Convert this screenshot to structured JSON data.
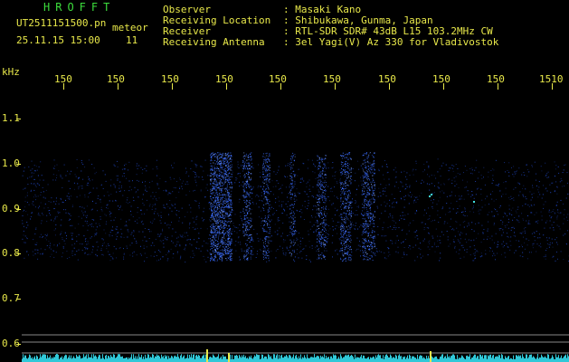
{
  "header": {
    "title": "HROFFT",
    "filename": "UT2511151500.pn",
    "mode": "meteor",
    "datetime": "25.11.15 15:00",
    "count": "11",
    "observer_label": "Observer",
    "observer_value": ": Masaki Kano",
    "location_label": "Receiving Location",
    "location_value": ": Shibukawa, Gunma, Japan",
    "receiver_label": "Receiver",
    "receiver_value": ": RTL-SDR SDR# 43dB L15 103.2MHz CW",
    "antenna_label": "Receiving Antenna",
    "antenna_value": ": 3el Yagi(V) Az 330 for Vladivostok"
  },
  "axis": {
    "unit": "kHz",
    "x_ticks": [
      "150",
      "150",
      "150",
      "150",
      "150",
      "150",
      "150",
      "150",
      "150",
      "1510"
    ],
    "y_ticks": [
      "1.1",
      "1.0",
      "0.9",
      "0.8",
      "0.7",
      "0.6"
    ]
  },
  "colors": {
    "text": "#e8e84a",
    "title": "#3cdc3c",
    "signal": "#2a5cff",
    "baseline": "#30c8d8"
  }
}
